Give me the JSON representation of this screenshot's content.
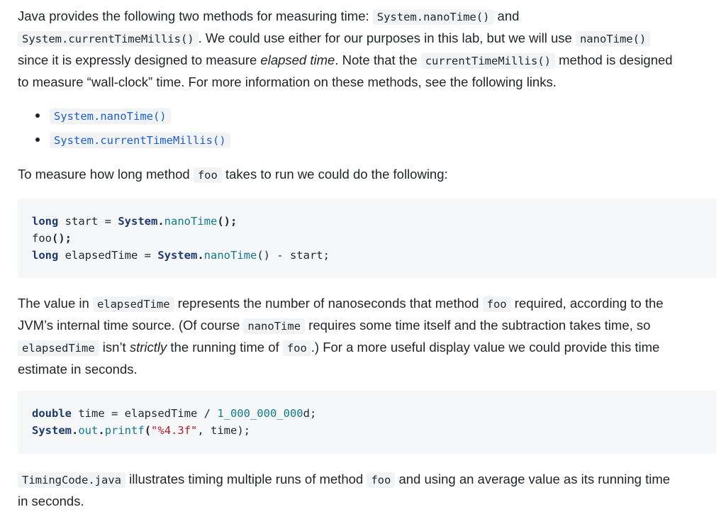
{
  "para1": {
    "t1": "Java provides the following two methods for measuring time: ",
    "c1": "System.nanoTime()",
    "t2": " and",
    "c2": "System.currentTimeMillis()",
    "t3": ". We could use either for our purposes in this lab, but we will use ",
    "c3": "nanoTime()",
    "t4": "since it is expressly designed to measure ",
    "em1": "elapsed time",
    "t5": ". Note that the ",
    "c4": "currentTimeMillis()",
    "t6": " method is designed",
    "t7": "to measure “wall-clock” time. For more information on these methods, see the following links."
  },
  "links": [
    {
      "label": "System.nanoTime()"
    },
    {
      "label": "System.currentTimeMillis()"
    }
  ],
  "para2": {
    "t1": "To measure how long method ",
    "c1": "foo",
    "t2": " takes to run we could do the following:"
  },
  "code1": {
    "l1": {
      "kw": "long",
      "a": " start = ",
      "cls": "System",
      "dot": ".",
      "fn": "nanoTime",
      "end": "();"
    },
    "l2": {
      "a": "foo",
      "end": "();"
    },
    "l3": {
      "kw": "long",
      "a": " elapsedTime = ",
      "cls": "System",
      "dot": ".",
      "fn": "nanoTime",
      "b": "() - start;"
    }
  },
  "para3": {
    "t1": "The value in ",
    "c1": "elapsedTime",
    "t2": " represents the number of nanoseconds that method ",
    "c2": "foo",
    "t3": " required, according to the",
    "t4": "JVM’s internal time source. (Of course ",
    "c3": "nanoTime",
    "t5": " requires some time itself and the subtraction takes time, so",
    "c4": "elapsedTime",
    "t6": " isn’t ",
    "em1": "strictly",
    "t7": " the running time of ",
    "c5": "foo",
    "t8": ".) For a more useful display value we could provide this time",
    "t9": "estimate in seconds."
  },
  "code2": {
    "l1": {
      "kw": "double",
      "a": " time = elapsedTime / ",
      "num": "1_000_000_000",
      "b": "d;"
    },
    "l2": {
      "cls": "System",
      "dot": ".",
      "fn1": "out",
      "dot2": ".",
      "fn2": "printf",
      "p1": "(",
      "str": "\"%4.3f\"",
      "b": ", time);"
    }
  },
  "para4": {
    "c1": "TimingCode.java",
    "t1": " illustrates timing multiple runs of method ",
    "c2": "foo",
    "t2": " and using an average value as its running time",
    "t3": "in seconds."
  }
}
